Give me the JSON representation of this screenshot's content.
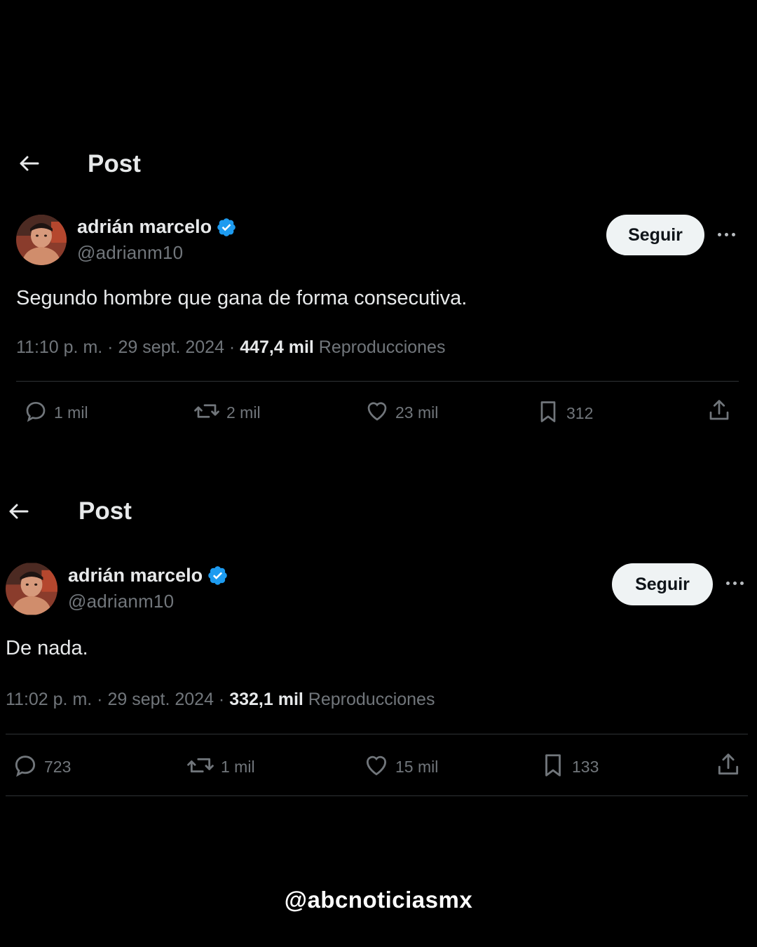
{
  "posts": [
    {
      "header_title": "Post",
      "display_name": "adrián marcelo",
      "handle": "@adrianm10",
      "follow_label": "Seguir",
      "text": "Segundo hombre que gana de forma consecutiva.",
      "time": "11:10 p. m.",
      "date": "29 sept. 2024",
      "separator": "·",
      "views_count": "447,4 mil",
      "views_label": "Reproducciones",
      "replies": "1 mil",
      "reposts": "2 mil",
      "likes": "23 mil",
      "bookmarks": "312"
    },
    {
      "header_title": "Post",
      "display_name": "adrián marcelo",
      "handle": "@adrianm10",
      "follow_label": "Seguir",
      "text": "De nada.",
      "time": "11:02 p. m.",
      "date": "29 sept. 2024",
      "separator": "·",
      "views_count": "332,1 mil",
      "views_label": "Reproducciones",
      "replies": "723",
      "reposts": "1 mil",
      "likes": "15 mil",
      "bookmarks": "133"
    }
  ],
  "icons": {
    "back": "arrow-left-icon",
    "verified": "verified-badge-icon",
    "more": "more-dots-icon",
    "reply": "reply-icon",
    "repost": "repost-icon",
    "like": "heart-icon",
    "bookmark": "bookmark-icon",
    "share": "share-icon"
  },
  "colors": {
    "background": "#000000",
    "text": "#e7e9ea",
    "secondary": "#71767b",
    "verified": "#1d9bf0",
    "follow_bg": "#eff3f4"
  },
  "watermark": "@abcnoticiasmx"
}
